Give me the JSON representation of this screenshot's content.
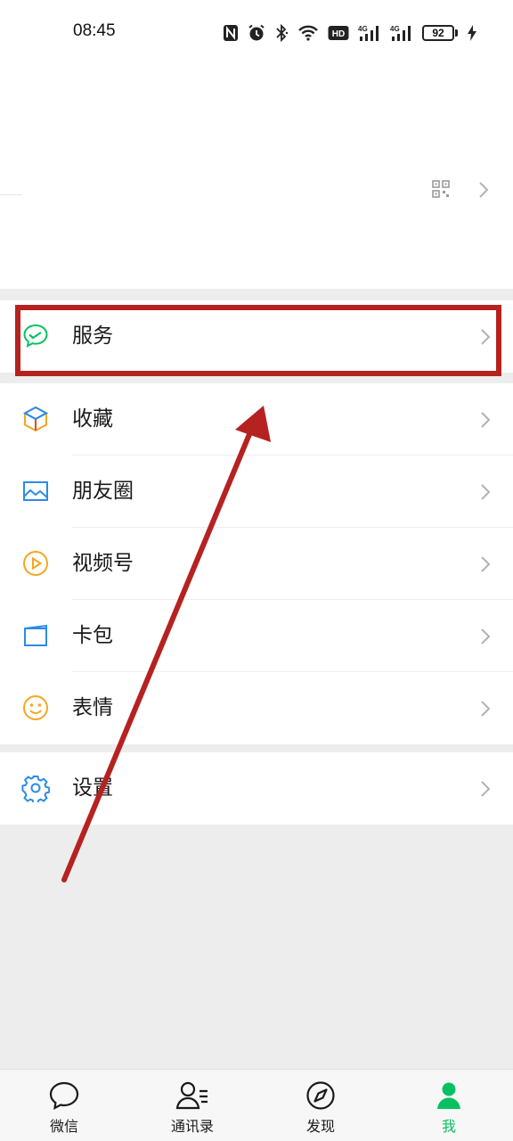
{
  "status_bar": {
    "time": "08:45",
    "battery": "92",
    "network_labels": [
      "4G",
      "4G"
    ],
    "hd_label": "HD"
  },
  "profile": {
    "qr_icon": "qr-code-icon",
    "chevron_icon": "chevron-right-icon"
  },
  "menu": {
    "services": {
      "label": "服务",
      "icon": "services-icon"
    },
    "items": [
      {
        "label": "收藏",
        "icon": "favorites-cube-icon"
      },
      {
        "label": "朋友圈",
        "icon": "moments-image-icon"
      },
      {
        "label": "视频号",
        "icon": "channels-play-icon"
      },
      {
        "label": "卡包",
        "icon": "card-wallet-icon"
      },
      {
        "label": "表情",
        "icon": "sticker-smile-icon"
      }
    ],
    "settings": {
      "label": "设置",
      "icon": "gear-icon"
    }
  },
  "tabbar": {
    "tabs": [
      {
        "label": "微信",
        "icon": "chat-bubble-icon"
      },
      {
        "label": "通讯录",
        "icon": "contacts-icon"
      },
      {
        "label": "发现",
        "icon": "compass-icon"
      },
      {
        "label": "我",
        "icon": "me-person-icon",
        "active": true
      }
    ]
  },
  "colors": {
    "accent_green": "#07c160",
    "annotation_red": "#b52220",
    "background": "#ededed"
  }
}
